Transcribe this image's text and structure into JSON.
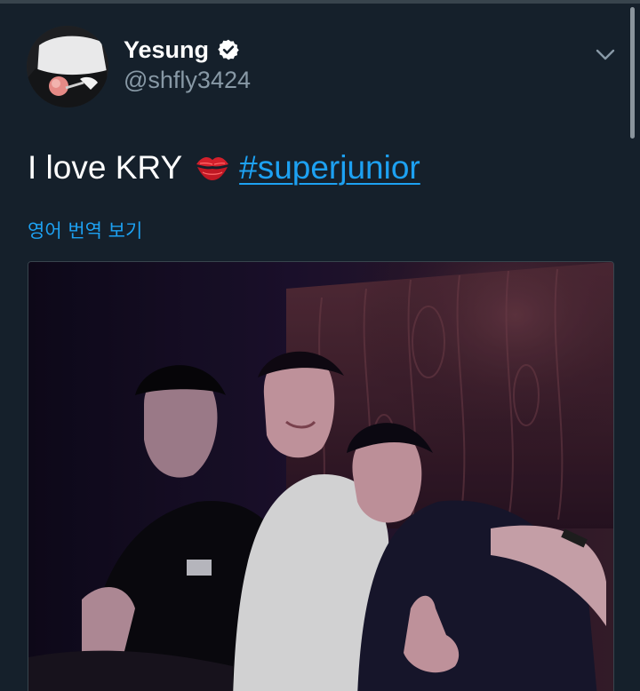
{
  "user": {
    "display_name": "Yesung",
    "handle": "@shfly3424",
    "verified": true
  },
  "tweet": {
    "text": "I love KRY",
    "emoji": "kiss-mark-icon",
    "hashtag": "#superjunior"
  },
  "translate": {
    "label": "영어 번역 보기"
  },
  "colors": {
    "background": "#15202b",
    "link": "#1da1f2",
    "handle": "#8899a6",
    "text": "#ffffff"
  },
  "icons": {
    "verified": "verified-badge-icon",
    "menu": "chevron-down-icon"
  }
}
